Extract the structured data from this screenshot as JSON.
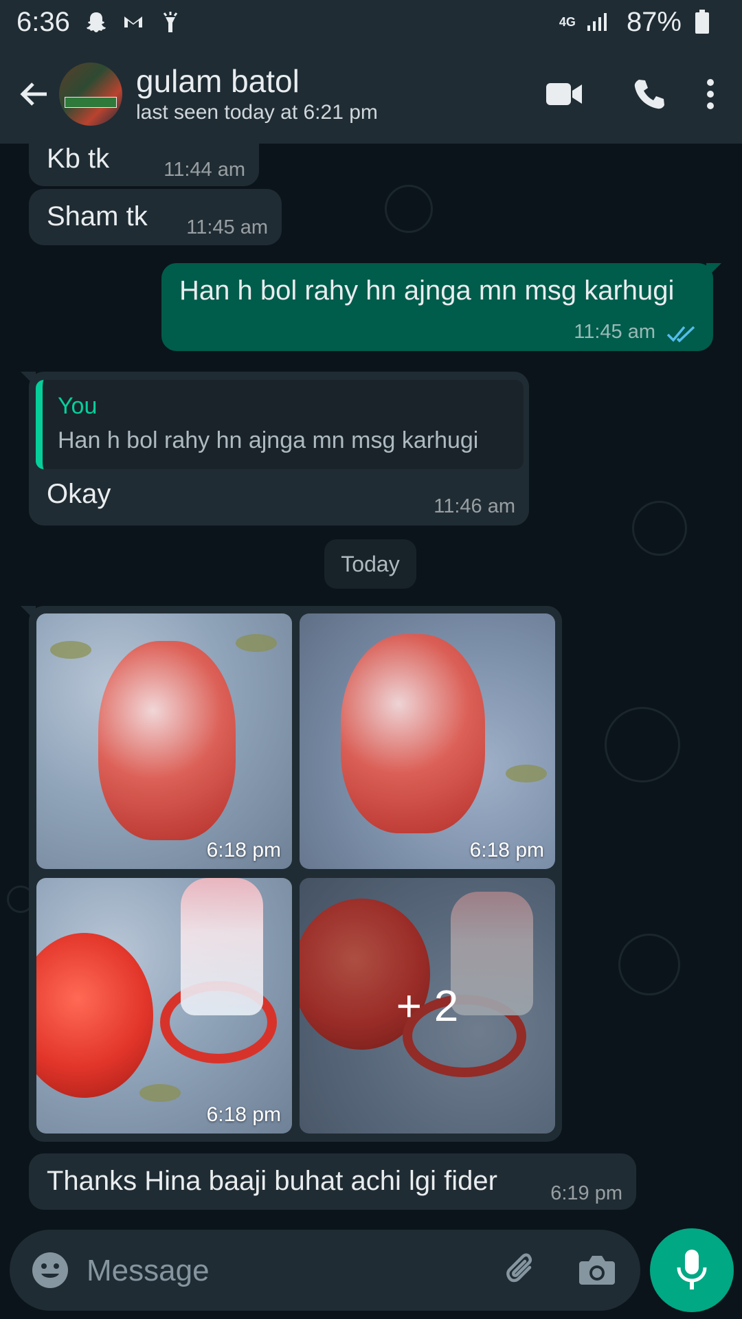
{
  "status_bar": {
    "time": "6:36",
    "network": "4G",
    "battery": "87%",
    "icons": [
      "snapchat-icon",
      "gmail-icon",
      "flashlight-icon",
      "signal-icon",
      "battery-icon"
    ]
  },
  "header": {
    "contact_name": "gulam batol",
    "last_seen": "last seen today at 6:21 pm",
    "icons": [
      "back-arrow-icon",
      "video-call-icon",
      "voice-call-icon",
      "more-options-icon"
    ]
  },
  "messages": [
    {
      "direction": "in",
      "text": "Kb tk",
      "time": "11:44 am"
    },
    {
      "direction": "in",
      "text": "Sham tk",
      "time": "11:45 am"
    },
    {
      "direction": "out",
      "text": "Han h bol rahy hn ajnga mn msg karhugi",
      "time": "11:45 am",
      "status": "read"
    },
    {
      "direction": "in",
      "quote_author": "You",
      "quote_text": "Han h bol rahy hn ajnga mn msg karhugi",
      "text": "Okay",
      "time": "11:46 am"
    }
  ],
  "date_divider": "Today",
  "media_group": {
    "photo_times": [
      "6:18 pm",
      "6:18 pm",
      "6:18 pm"
    ],
    "more_count": "+ 2"
  },
  "last_message": {
    "direction": "in",
    "text": "Thanks Hina baaji buhat achi lgi fider",
    "time": "6:19 pm"
  },
  "composer": {
    "placeholder": "Message",
    "icons": [
      "emoji-icon",
      "attach-icon",
      "camera-icon",
      "mic-icon"
    ]
  },
  "colors": {
    "background": "#0b141a",
    "header": "#1f2c34",
    "incoming_bubble": "#202c33",
    "outgoing_bubble": "#005c4b",
    "accent": "#00a884",
    "read_ticks": "#53bdeb"
  }
}
